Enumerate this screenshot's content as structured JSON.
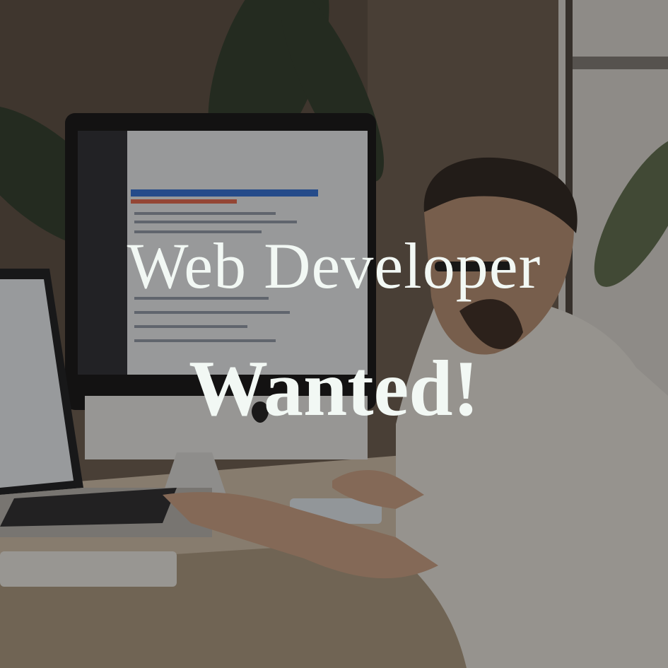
{
  "headline": {
    "line1": "Web Developer",
    "line2": "Wanted!"
  },
  "colors": {
    "text": "#f2f8f4",
    "overlay": "#141210",
    "code_highlight": "#2f6fd6",
    "code_accent": "#e2674c"
  },
  "icons": {
    "monitor_logo": "apple-logo-icon"
  }
}
